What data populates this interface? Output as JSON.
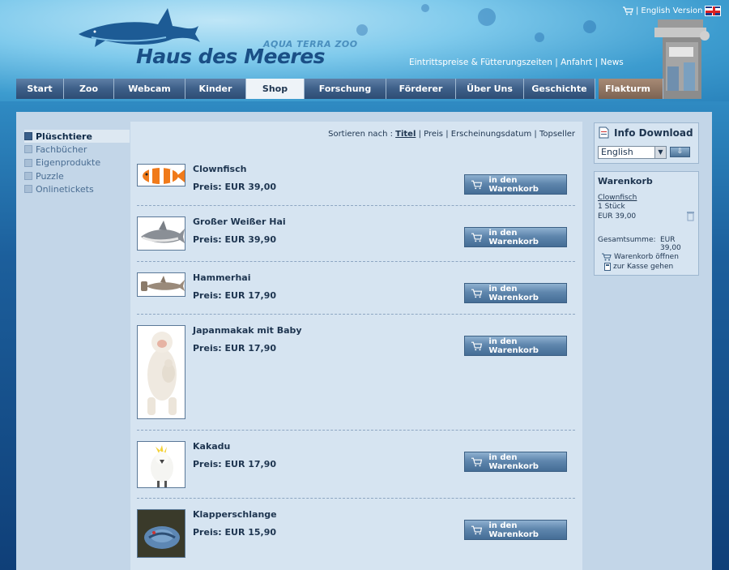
{
  "header": {
    "tagline": "AQUA TERRA ZOO",
    "title": "Haus des Meeres",
    "top_links": [
      "Eintrittspreise & Fütterungszeiten",
      "Anfahrt",
      "News"
    ],
    "lang_link": "English Version"
  },
  "nav": {
    "items": [
      "Start",
      "Zoo",
      "Webcam",
      "Kinder",
      "Shop",
      "Forschung",
      "Förderer",
      "Über Uns",
      "Geschichte"
    ],
    "special": "Flakturm",
    "active": "Shop"
  },
  "sidebar": {
    "items": [
      "Plüschtiere",
      "Fachbücher",
      "Eigenprodukte",
      "Puzzle",
      "Onlinetickets"
    ],
    "active": "Plüschtiere"
  },
  "sort": {
    "label": "Sortieren nach :",
    "options": [
      "Titel",
      "Preis",
      "Erscheinungsdatum",
      "Topseller"
    ],
    "active": "Titel"
  },
  "products": [
    {
      "name": "Clownfisch",
      "price": "Preis: EUR 39,00",
      "icon": "clownfish-thumbnail"
    },
    {
      "name": "Großer Weißer Hai",
      "price": "Preis: EUR 39,90",
      "icon": "shark-thumbnail"
    },
    {
      "name": "Hammerhai",
      "price": "Preis: EUR 17,90",
      "icon": "hammerhead-thumbnail"
    },
    {
      "name": "Japanmakak mit Baby",
      "price": "Preis: EUR 17,90",
      "icon": "macaque-thumbnail"
    },
    {
      "name": "Kakadu",
      "price": "Preis: EUR 17,90",
      "icon": "cockatoo-thumbnail"
    },
    {
      "name": "Klapperschlange",
      "price": "Preis: EUR 15,90",
      "icon": "snake-thumbnail"
    }
  ],
  "cart_button_label": "in den Warenkorb",
  "info_download": {
    "title": "Info Download",
    "selected_language": "English"
  },
  "warenkorb": {
    "title": "Warenkorb",
    "item_name": "Clownfisch",
    "item_qty": "1 Stück",
    "item_price": "EUR 39,00",
    "total_label": "Gesamtsumme:",
    "total_value": "EUR 39,00",
    "open_link": "Warenkorb öffnen",
    "checkout_link": "zur Kasse gehen"
  },
  "colors": {
    "nav_bg": "#3d5f88",
    "content_bg": "#d6e4f1",
    "button_bg": "#5f86ad",
    "text": "#1e3550"
  }
}
